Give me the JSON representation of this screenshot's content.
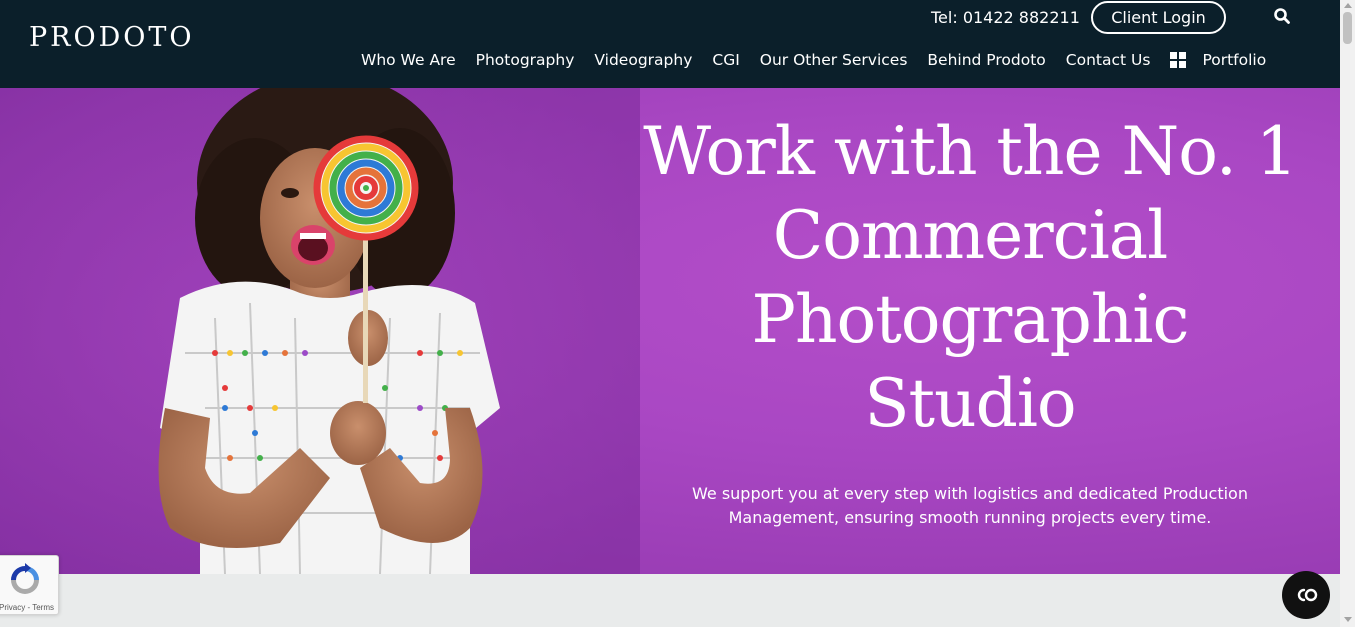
{
  "header": {
    "logo": "PRODOTO",
    "tel": "Tel: 01422 882211",
    "client_login": "Client Login",
    "search_icon": "search-icon",
    "nav": [
      {
        "label": "Who We Are"
      },
      {
        "label": "Photography"
      },
      {
        "label": "Videography"
      },
      {
        "label": "CGI"
      },
      {
        "label": "Our Other Services"
      },
      {
        "label": "Behind Prodoto"
      },
      {
        "label": "Contact Us"
      }
    ],
    "portfolio": {
      "label": "Portfolio",
      "icon": "grid-icon"
    }
  },
  "hero": {
    "headline_lines": [
      "Work with the No. 1",
      "Commercial",
      "Photographic",
      "Studio"
    ],
    "subtext_lines": [
      "We support you at every step with logistics and dedicated Production",
      "Management, ensuring smooth running projects every time."
    ],
    "image_icon": "woman-with-lollipop-photo"
  },
  "recaptcha": {
    "text": "Privacy - Terms"
  },
  "chat": {
    "icon": "chat-bubble-icon"
  },
  "colors": {
    "header_bg": "#0b1f2a",
    "hero_bg": "#a947c3",
    "below_bg": "#e9ebeb",
    "text": "#ffffff"
  }
}
